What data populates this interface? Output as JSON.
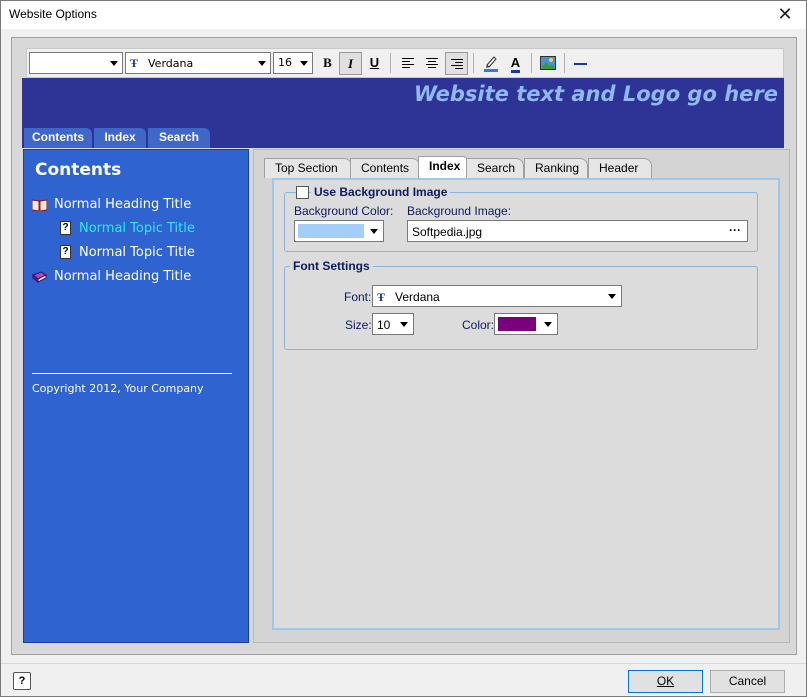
{
  "window": {
    "title": "Website Options",
    "close_glyph": "✕"
  },
  "toolbar": {
    "style_combo_value": "",
    "font_combo_value": "Verdana",
    "size_combo_value": "16",
    "bold": "B",
    "italic": "I",
    "underline": "U",
    "font_icon_glyph": "Ŧ",
    "highlight_icon": "highlight-pen-icon",
    "font_color_glyph": "A",
    "image_icon": "insert-image-icon",
    "line_icon": "horizontal-line-icon"
  },
  "banner": {
    "text": "Website text and Logo go here",
    "tabs": [
      "Contents",
      "Index",
      "Search"
    ],
    "background_color": "#2e3496",
    "text_color": "#8fb8f4"
  },
  "preview": {
    "title": "Contents",
    "items": [
      {
        "label": "Normal Heading Title",
        "icon": "open-book-icon"
      },
      {
        "label": "Normal Topic Title",
        "icon": "help-page-icon",
        "selected": true
      },
      {
        "label": "Normal Topic Title",
        "icon": "help-page-icon"
      },
      {
        "label": "Normal Heading Title",
        "icon": "closed-book-icon"
      }
    ],
    "copyright": "Copyright 2012, Your Company",
    "background_color": "#2f63cf",
    "selected_color": "#2ee8ff"
  },
  "tabs": [
    "Top Section",
    "Contents",
    "Index",
    "Search",
    "Ranking",
    "Header"
  ],
  "active_tab": "Index",
  "background_group": {
    "checkbox_label": "Use Background Image",
    "checked": false,
    "bg_color_label": "Background Color:",
    "bg_color_value": "#a4cdf8",
    "bg_image_label": "Background Image:",
    "bg_image_value": "Softpedia.jpg",
    "browse_glyph": "···"
  },
  "font_group": {
    "legend": "Font Settings",
    "font_label": "Font:",
    "font_value": "Verdana",
    "size_label": "Size:",
    "size_value": "10",
    "color_label": "Color:",
    "color_value": "#7b007b"
  },
  "buttons": {
    "help_glyph": "?",
    "ok": "OK",
    "cancel": "Cancel"
  }
}
